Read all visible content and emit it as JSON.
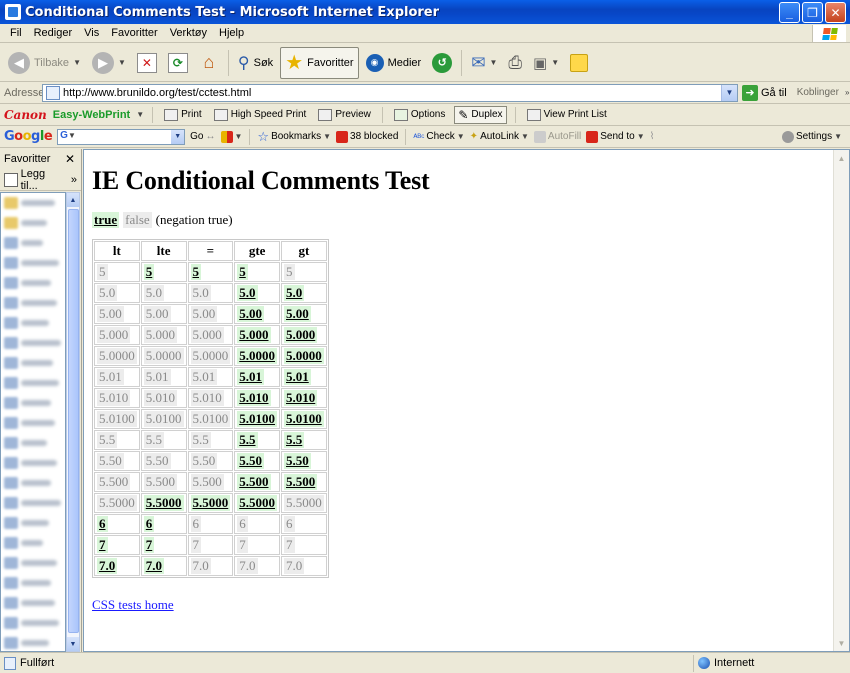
{
  "window": {
    "title": "Conditional Comments Test - Microsoft Internet Explorer"
  },
  "menu": [
    "Fil",
    "Rediger",
    "Vis",
    "Favoritter",
    "Verktøy",
    "Hjelp"
  ],
  "toolbar": {
    "back": "Tilbake",
    "search": "Søk",
    "favorites": "Favoritter",
    "media": "Medier"
  },
  "address": {
    "label": "Adresse",
    "url": "http://www.brunildo.org/test/cctest.html",
    "go": "Gå til",
    "links": "Koblinger"
  },
  "canon": {
    "brand": "Canon",
    "product": "Easy-WebPrint",
    "print": "Print",
    "high_speed": "High Speed Print",
    "preview": "Preview",
    "options": "Options",
    "duplex": "Duplex",
    "view_list": "View Print List"
  },
  "google": {
    "logo": "Google",
    "go": "Go",
    "bookmarks": "Bookmarks",
    "blocked": "38 blocked",
    "check": "Check",
    "autolink": "AutoLink",
    "autofill": "AutoFill",
    "sendto": "Send to",
    "settings": "Settings"
  },
  "favorites_pane": {
    "title": "Favoritter",
    "add": "Legg til..."
  },
  "page": {
    "heading": "IE Conditional Comments Test",
    "legend_true": "true",
    "legend_false": "false",
    "legend_note": "(negation true)",
    "columns": [
      "lt",
      "lte",
      "=",
      "gte",
      "gt"
    ],
    "rows": [
      [
        [
          "5",
          false
        ],
        [
          "5",
          true
        ],
        [
          "5",
          true
        ],
        [
          "5",
          true
        ],
        [
          "5",
          false
        ]
      ],
      [
        [
          "5.0",
          false
        ],
        [
          "5.0",
          false
        ],
        [
          "5.0",
          false
        ],
        [
          "5.0",
          true
        ],
        [
          "5.0",
          true
        ]
      ],
      [
        [
          "5.00",
          false
        ],
        [
          "5.00",
          false
        ],
        [
          "5.00",
          false
        ],
        [
          "5.00",
          true
        ],
        [
          "5.00",
          true
        ]
      ],
      [
        [
          "5.000",
          false
        ],
        [
          "5.000",
          false
        ],
        [
          "5.000",
          false
        ],
        [
          "5.000",
          true
        ],
        [
          "5.000",
          true
        ]
      ],
      [
        [
          "5.0000",
          false
        ],
        [
          "5.0000",
          false
        ],
        [
          "5.0000",
          false
        ],
        [
          "5.0000",
          true
        ],
        [
          "5.0000",
          true
        ]
      ],
      [
        [
          "5.01",
          false
        ],
        [
          "5.01",
          false
        ],
        [
          "5.01",
          false
        ],
        [
          "5.01",
          true
        ],
        [
          "5.01",
          true
        ]
      ],
      [
        [
          "5.010",
          false
        ],
        [
          "5.010",
          false
        ],
        [
          "5.010",
          false
        ],
        [
          "5.010",
          true
        ],
        [
          "5.010",
          true
        ]
      ],
      [
        [
          "5.0100",
          false
        ],
        [
          "5.0100",
          false
        ],
        [
          "5.0100",
          false
        ],
        [
          "5.0100",
          true
        ],
        [
          "5.0100",
          true
        ]
      ],
      [
        [
          "5.5",
          false
        ],
        [
          "5.5",
          false
        ],
        [
          "5.5",
          false
        ],
        [
          "5.5",
          true
        ],
        [
          "5.5",
          true
        ]
      ],
      [
        [
          "5.50",
          false
        ],
        [
          "5.50",
          false
        ],
        [
          "5.50",
          false
        ],
        [
          "5.50",
          true
        ],
        [
          "5.50",
          true
        ]
      ],
      [
        [
          "5.500",
          false
        ],
        [
          "5.500",
          false
        ],
        [
          "5.500",
          false
        ],
        [
          "5.500",
          true
        ],
        [
          "5.500",
          true
        ]
      ],
      [
        [
          "5.5000",
          false
        ],
        [
          "5.5000",
          true
        ],
        [
          "5.5000",
          true
        ],
        [
          "5.5000",
          true
        ],
        [
          "5.5000",
          false
        ]
      ],
      [
        [
          "6",
          true
        ],
        [
          "6",
          true
        ],
        [
          "6",
          false
        ],
        [
          "6",
          false
        ],
        [
          "6",
          false
        ]
      ],
      [
        [
          "7",
          true
        ],
        [
          "7",
          true
        ],
        [
          "7",
          false
        ],
        [
          "7",
          false
        ],
        [
          "7",
          false
        ]
      ],
      [
        [
          "7.0",
          true
        ],
        [
          "7.0",
          true
        ],
        [
          "7.0",
          false
        ],
        [
          "7.0",
          false
        ],
        [
          "7.0",
          false
        ]
      ]
    ],
    "home_link": "CSS tests home"
  },
  "status": {
    "text": "Fullført",
    "zone": "Internett"
  }
}
